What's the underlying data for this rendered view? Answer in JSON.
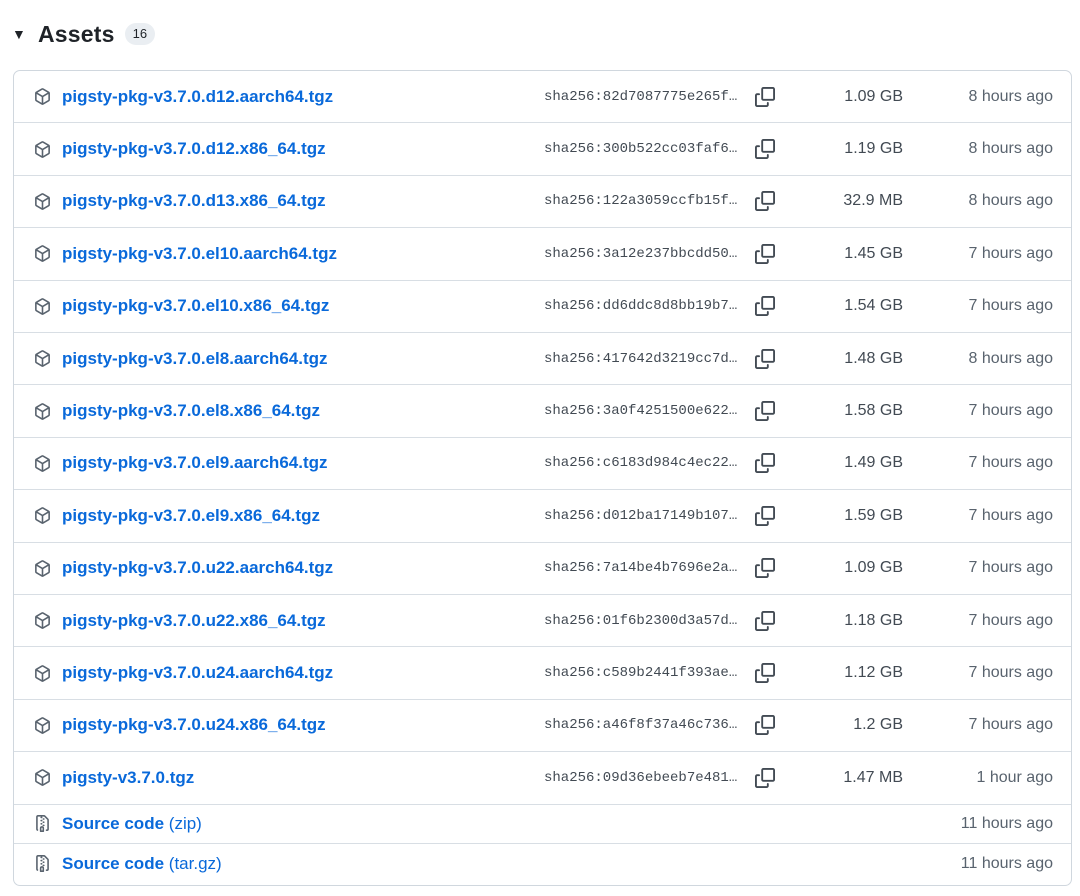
{
  "header": {
    "title": "Assets",
    "count": "16",
    "caret": "▼"
  },
  "assets": [
    {
      "name": "pigsty-pkg-v3.7.0.d12.aarch64.tgz",
      "sha": "sha256:82d7087775e265f…",
      "size": "1.09 GB",
      "time": "8 hours ago",
      "icon": "package-icon"
    },
    {
      "name": "pigsty-pkg-v3.7.0.d12.x86_64.tgz",
      "sha": "sha256:300b522cc03faf6…",
      "size": "1.19 GB",
      "time": "8 hours ago",
      "icon": "package-icon"
    },
    {
      "name": "pigsty-pkg-v3.7.0.d13.x86_64.tgz",
      "sha": "sha256:122a3059ccfb15f…",
      "size": "32.9 MB",
      "time": "8 hours ago",
      "icon": "package-icon"
    },
    {
      "name": "pigsty-pkg-v3.7.0.el10.aarch64.tgz",
      "sha": "sha256:3a12e237bbcdd50…",
      "size": "1.45 GB",
      "time": "7 hours ago",
      "icon": "package-icon"
    },
    {
      "name": "pigsty-pkg-v3.7.0.el10.x86_64.tgz",
      "sha": "sha256:dd6ddc8d8bb19b7…",
      "size": "1.54 GB",
      "time": "7 hours ago",
      "icon": "package-icon"
    },
    {
      "name": "pigsty-pkg-v3.7.0.el8.aarch64.tgz",
      "sha": "sha256:417642d3219cc7d…",
      "size": "1.48 GB",
      "time": "8 hours ago",
      "icon": "package-icon"
    },
    {
      "name": "pigsty-pkg-v3.7.0.el8.x86_64.tgz",
      "sha": "sha256:3a0f4251500e622…",
      "size": "1.58 GB",
      "time": "7 hours ago",
      "icon": "package-icon"
    },
    {
      "name": "pigsty-pkg-v3.7.0.el9.aarch64.tgz",
      "sha": "sha256:c6183d984c4ec22…",
      "size": "1.49 GB",
      "time": "7 hours ago",
      "icon": "package-icon"
    },
    {
      "name": "pigsty-pkg-v3.7.0.el9.x86_64.tgz",
      "sha": "sha256:d012ba17149b107…",
      "size": "1.59 GB",
      "time": "7 hours ago",
      "icon": "package-icon"
    },
    {
      "name": "pigsty-pkg-v3.7.0.u22.aarch64.tgz",
      "sha": "sha256:7a14be4b7696e2a…",
      "size": "1.09 GB",
      "time": "7 hours ago",
      "icon": "package-icon"
    },
    {
      "name": "pigsty-pkg-v3.7.0.u22.x86_64.tgz",
      "sha": "sha256:01f6b2300d3a57d…",
      "size": "1.18 GB",
      "time": "7 hours ago",
      "icon": "package-icon"
    },
    {
      "name": "pigsty-pkg-v3.7.0.u24.aarch64.tgz",
      "sha": "sha256:c589b2441f393ae…",
      "size": "1.12 GB",
      "time": "7 hours ago",
      "icon": "package-icon"
    },
    {
      "name": "pigsty-pkg-v3.7.0.u24.x86_64.tgz",
      "sha": "sha256:a46f8f37a46c736…",
      "size": "1.2 GB",
      "time": "7 hours ago",
      "icon": "package-icon"
    },
    {
      "name": "pigsty-v3.7.0.tgz",
      "sha": "sha256:09d36ebeeb7e481…",
      "size": "1.47 MB",
      "time": "1 hour ago",
      "icon": "package-icon"
    }
  ],
  "source": [
    {
      "name": "Source code",
      "suffix": "(zip)",
      "time": "11 hours ago",
      "icon": "file-zip-icon"
    },
    {
      "name": "Source code",
      "suffix": "(tar.gz)",
      "time": "11 hours ago",
      "icon": "file-zip-icon"
    }
  ],
  "colors": {
    "link": "#0969da",
    "border": "#d0d7de",
    "muted": "#59636e"
  }
}
